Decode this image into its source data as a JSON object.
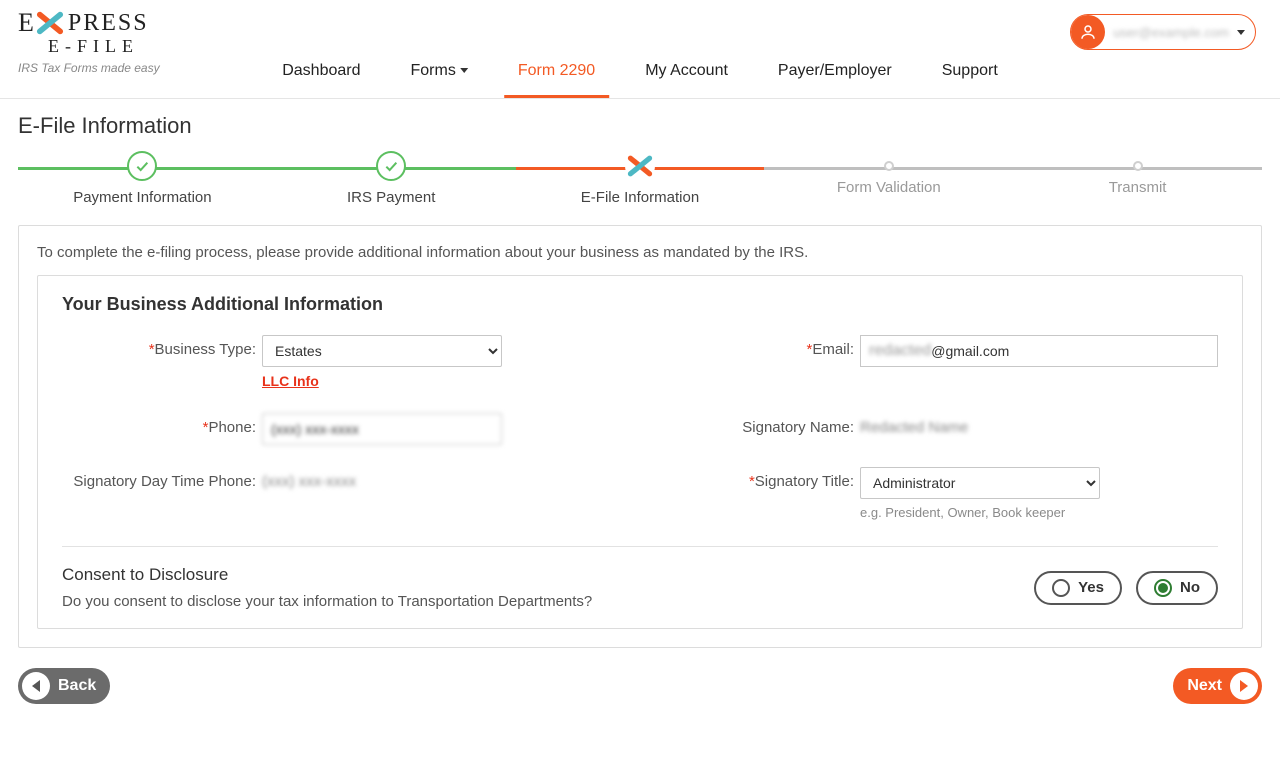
{
  "logo": {
    "line1": "PRESS",
    "line2": "E-FILE",
    "tag": "IRS Tax Forms made easy"
  },
  "nav": {
    "dashboard": "Dashboard",
    "forms": "Forms",
    "form2290": "Form 2290",
    "myaccount": "My Account",
    "payer": "Payer/Employer",
    "support": "Support"
  },
  "user": {
    "name": "user@example.com"
  },
  "page_title": "E-File Information",
  "steps": {
    "s1": "Payment Information",
    "s2": "IRS Payment",
    "s3": "E-File Information",
    "s4": "Form Validation",
    "s5": "Transmit"
  },
  "instr": "To complete the e-filing process, please provide additional information about your business as mandated by the IRS.",
  "section1_title": "Your Business Additional Information",
  "labels": {
    "business_type": "Business Type:",
    "email": "Email:",
    "phone": "Phone:",
    "sig_name": "Signatory Name:",
    "sig_day_phone": "Signatory Day Time Phone:",
    "sig_title": "Signatory Title:"
  },
  "values": {
    "business_type": "Estates",
    "llc_info": "LLC Info",
    "email": "@gmail.com",
    "email_prefix": "redacted",
    "phone": "(xxx) xxx-xxxx",
    "sig_name": "Redacted Name",
    "sig_day_phone": "(xxx) xxx-xxxx",
    "sig_title": "Administrator",
    "sig_title_hint": "e.g. President, Owner, Book keeper"
  },
  "consent": {
    "title": "Consent to Disclosure",
    "question": "Do you consent to disclose your tax information to Transportation Departments?",
    "yes": "Yes",
    "no": "No",
    "selected": "no"
  },
  "buttons": {
    "back": "Back",
    "next": "Next"
  }
}
